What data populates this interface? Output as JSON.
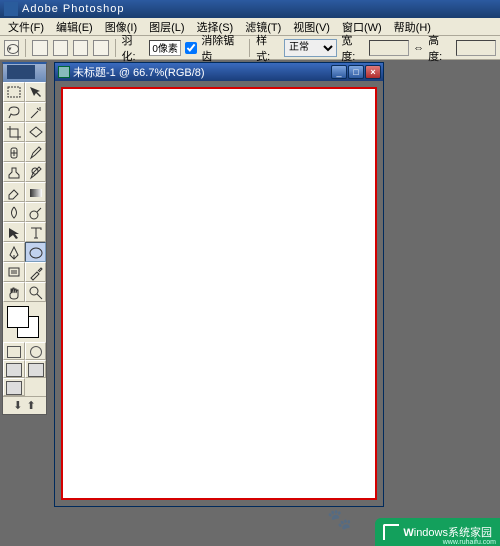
{
  "app": {
    "title": "Adobe Photoshop"
  },
  "menus": [
    "文件(F)",
    "编辑(E)",
    "图像(I)",
    "图层(L)",
    "选择(S)",
    "滤镜(T)",
    "视图(V)",
    "窗口(W)",
    "帮助(H)"
  ],
  "optionbar": {
    "feather_label": "羽化:",
    "feather_value": "0像素",
    "antialias_label": "消除锯齿",
    "style_label": "样式:",
    "style_value": "正常",
    "width_label": "宽度:",
    "height_label": "高度:"
  },
  "document": {
    "title": "未标题-1 @ 66.7%(RGB/8)"
  },
  "colors": {
    "foreground": "#ffffff",
    "background": "#ffffff"
  },
  "watermark": {
    "brand_a": "W",
    "brand_b": "indows",
    "brand_c": "系统家园",
    "url": "www.ruhaifu.com"
  }
}
